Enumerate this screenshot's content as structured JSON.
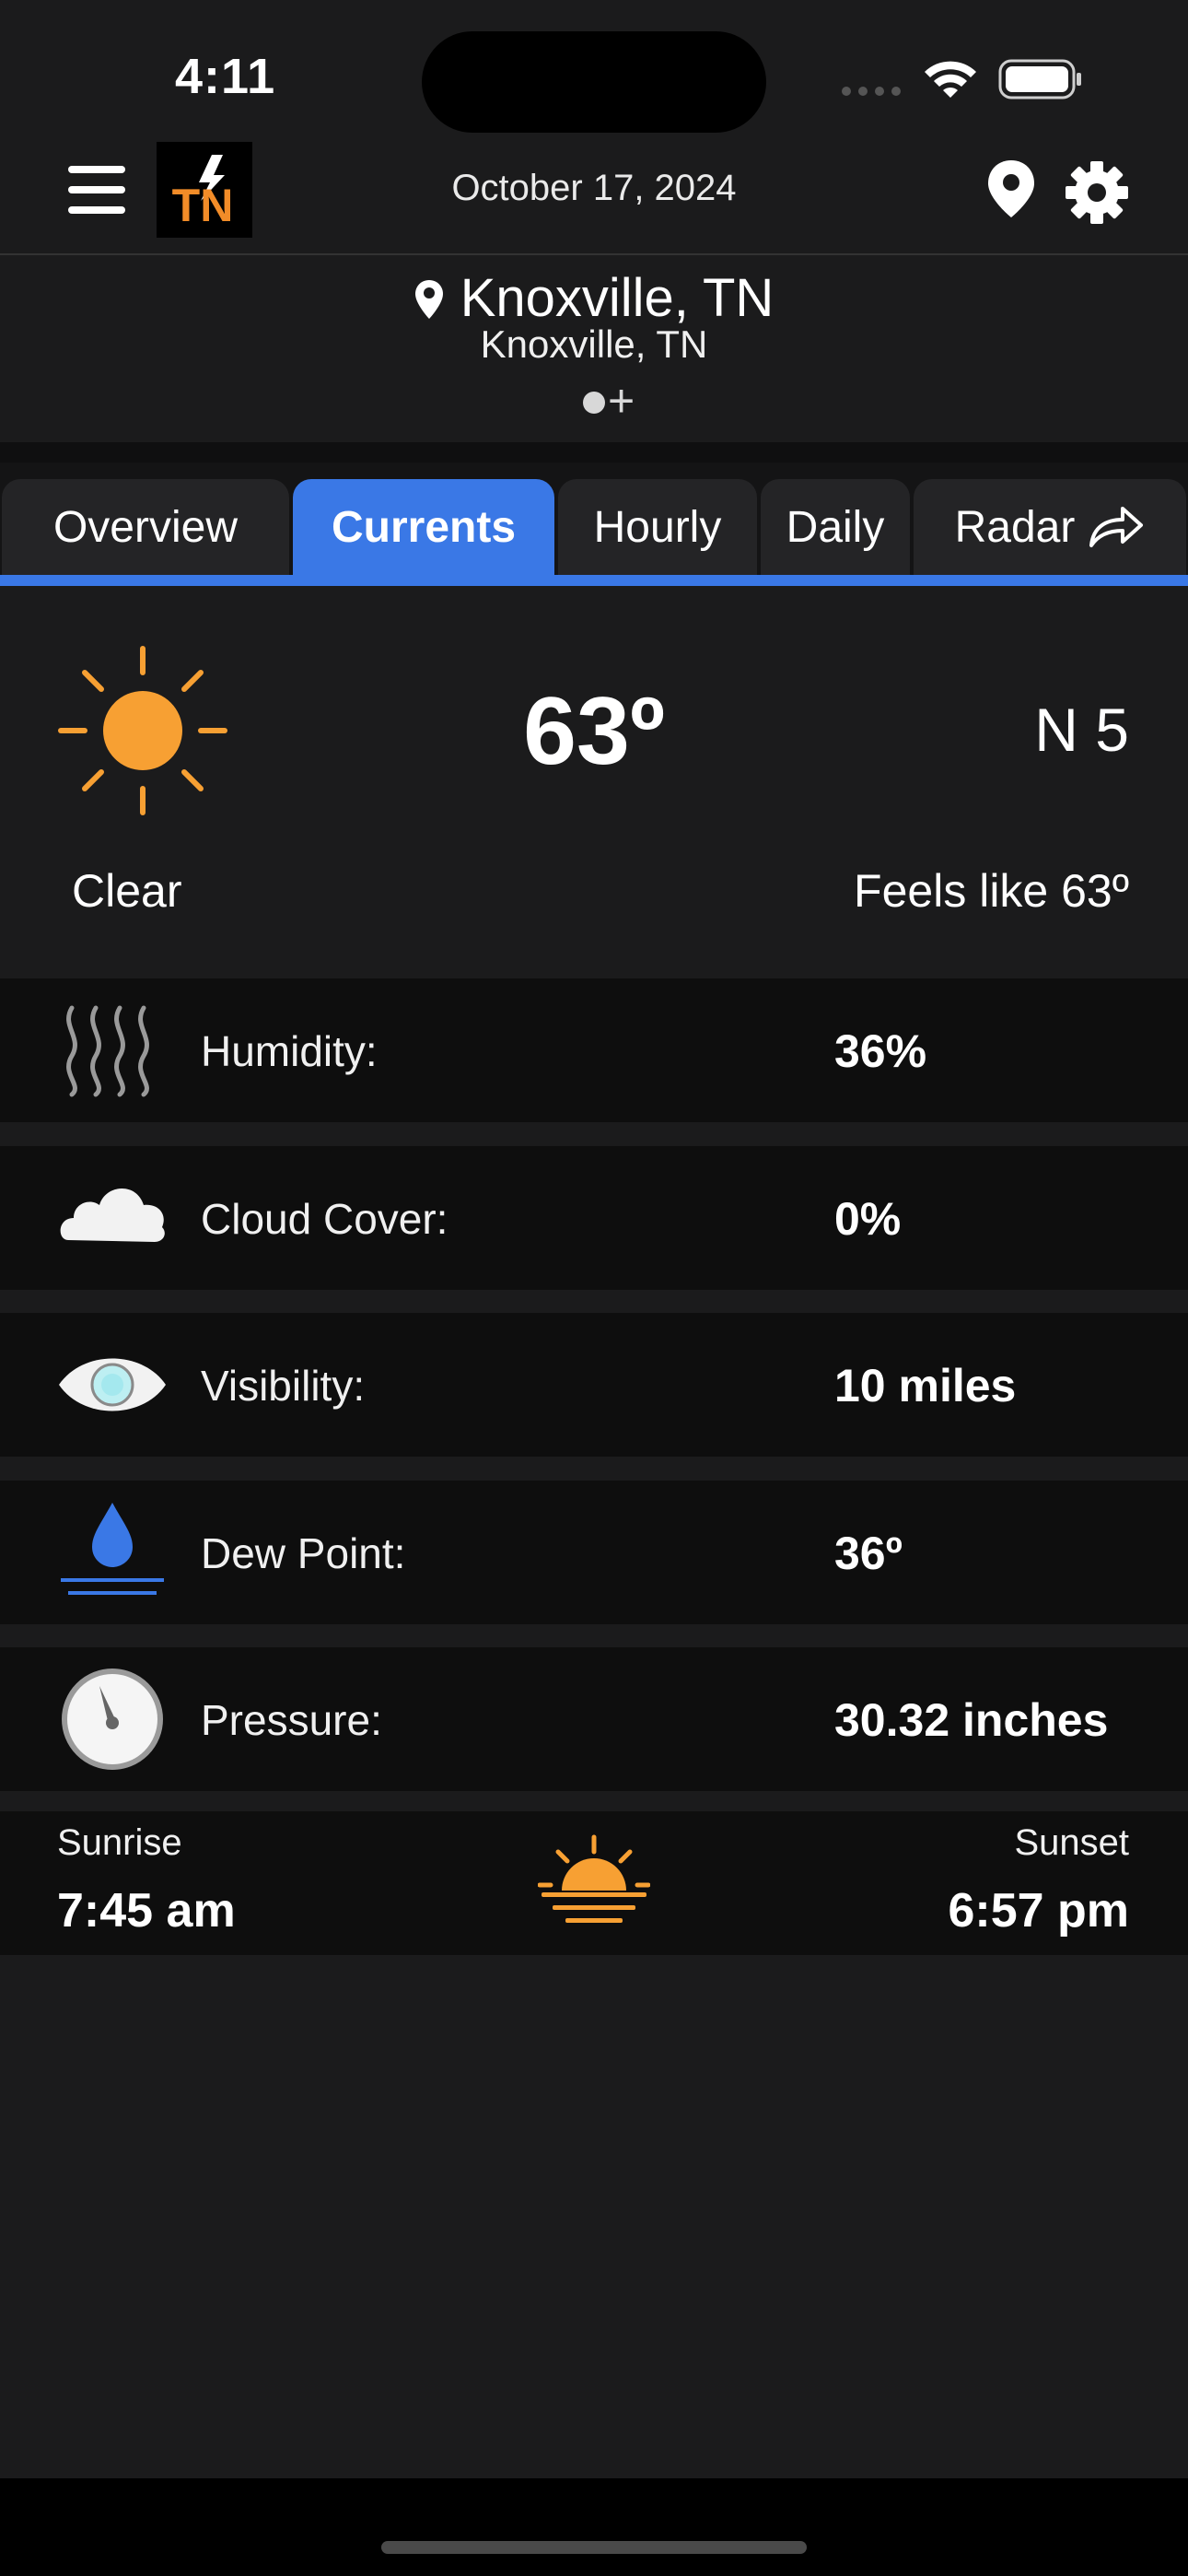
{
  "status_bar": {
    "time": "4:11"
  },
  "header": {
    "date": "October 17, 2024",
    "logo_text": "TN"
  },
  "location": {
    "title": "Knoxville, TN",
    "subtitle": "Knoxville, TN",
    "add_symbol": "+"
  },
  "tabs": [
    {
      "label": "Overview",
      "active": false
    },
    {
      "label": "Currents",
      "active": true
    },
    {
      "label": "Hourly",
      "active": false
    },
    {
      "label": "Daily",
      "active": false
    },
    {
      "label": "Radar",
      "active": false
    }
  ],
  "current": {
    "temperature": "63º",
    "wind": "N 5",
    "condition": "Clear",
    "feels_like": "Feels like 63º"
  },
  "details": [
    {
      "icon": "humidity-icon",
      "label": "Humidity:",
      "value": "36%"
    },
    {
      "icon": "cloud-icon",
      "label": "Cloud Cover:",
      "value": "0%"
    },
    {
      "icon": "eye-icon",
      "label": "Visibility:",
      "value": "10 miles"
    },
    {
      "icon": "dew-drop-icon",
      "label": "Dew Point:",
      "value": "36º"
    },
    {
      "icon": "pressure-gauge-icon",
      "label": "Pressure:",
      "value": "30.32 inches"
    }
  ],
  "sun": {
    "sunrise_label": "Sunrise",
    "sunrise_time": "7:45 am",
    "sunset_label": "Sunset",
    "sunset_time": "6:57 pm"
  },
  "colors": {
    "accent": "#3a78e6",
    "sun": "#f7a033",
    "background": "#1b1b1c"
  }
}
